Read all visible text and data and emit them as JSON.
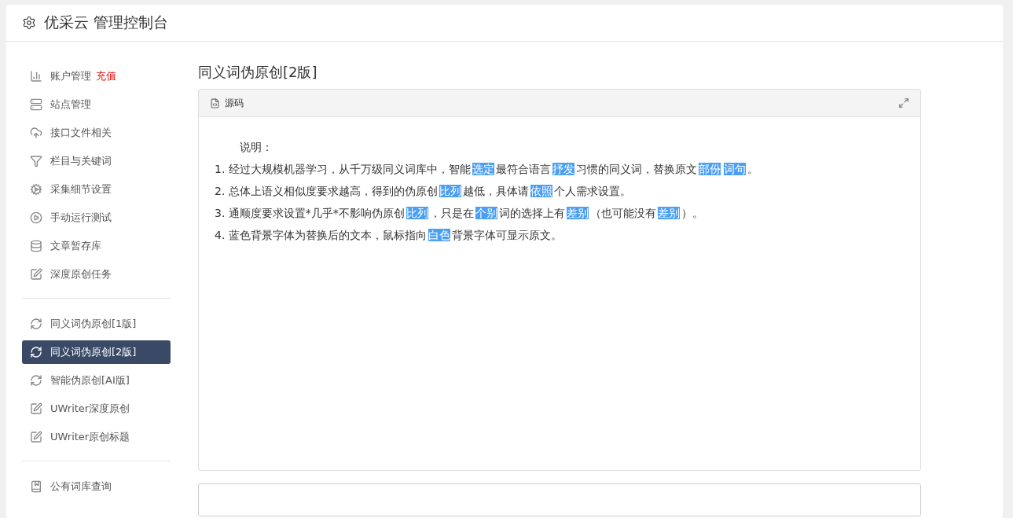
{
  "header": {
    "title": "优采云 管理控制台"
  },
  "sidebar": {
    "groups": [
      {
        "items": [
          {
            "label": "账户管理",
            "badge": "充值",
            "selected": false
          },
          {
            "label": "站点管理",
            "selected": false
          },
          {
            "label": "接口文件相关",
            "selected": false
          },
          {
            "label": "栏目与关键词",
            "selected": false
          },
          {
            "label": "采集细节设置",
            "selected": false
          },
          {
            "label": "手动运行测试",
            "selected": false
          },
          {
            "label": "文章暂存库",
            "selected": false
          },
          {
            "label": "深度原创任务",
            "selected": false
          }
        ]
      },
      {
        "items": [
          {
            "label": "同义词伪原创[1版]",
            "selected": false
          },
          {
            "label": "同义词伪原创[2版]",
            "selected": true
          },
          {
            "label": "智能伪原创[AI版]",
            "selected": false
          },
          {
            "label": "UWriter深度原创",
            "selected": false
          },
          {
            "label": "UWriter原创标题",
            "selected": false
          }
        ]
      },
      {
        "items": [
          {
            "label": "公有词库查询",
            "selected": false
          }
        ]
      }
    ]
  },
  "main": {
    "title": "同义词伪原创[2版]",
    "editor": {
      "toolbar_button": "源码",
      "heading": "说明：",
      "lines": [
        {
          "segments": [
            {
              "text": "1. 经过大规模机器学习，从千万级同义词库中，智能",
              "replaced": false
            },
            {
              "text": "选定",
              "replaced": true
            },
            {
              "text": "最符合语言",
              "replaced": false
            },
            {
              "text": "抒发",
              "replaced": true
            },
            {
              "text": "习惯的同义词，替换原文",
              "replaced": false
            },
            {
              "text": "部份",
              "replaced": true
            },
            {
              "text": "词句",
              "replaced": true
            },
            {
              "text": "。",
              "replaced": false
            }
          ]
        },
        {
          "segments": [
            {
              "text": "2. 总体上语义相似度要求越高，得到的伪原创",
              "replaced": false
            },
            {
              "text": "比列",
              "replaced": true
            },
            {
              "text": "越低，具体请",
              "replaced": false
            },
            {
              "text": "依照",
              "replaced": true
            },
            {
              "text": "个人需求设置。",
              "replaced": false
            }
          ]
        },
        {
          "segments": [
            {
              "text": "3. 通顺度要求设置*几乎*不影响伪原创",
              "replaced": false
            },
            {
              "text": "比列",
              "replaced": true
            },
            {
              "text": "，只是在",
              "replaced": false
            },
            {
              "text": "个别",
              "replaced": true
            },
            {
              "text": "词的选择上有",
              "replaced": false
            },
            {
              "text": "差别",
              "replaced": true
            },
            {
              "text": "（也可能没有",
              "replaced": false
            },
            {
              "text": "差别",
              "replaced": true
            },
            {
              "text": "）。",
              "replaced": false
            }
          ]
        },
        {
          "segments": [
            {
              "text": "4. 蓝色背景字体为替换后的文本，鼠标指向",
              "replaced": false
            },
            {
              "text": "白色",
              "replaced": true
            },
            {
              "text": "背景字体可显示原文。",
              "replaced": false
            }
          ]
        }
      ]
    }
  }
}
